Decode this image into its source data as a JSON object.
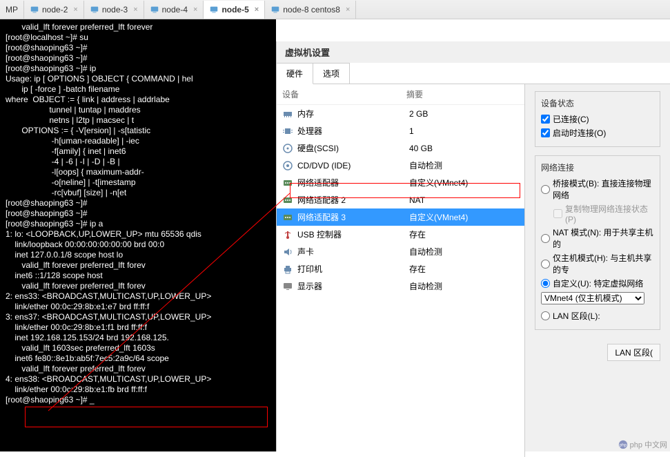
{
  "tabs": [
    {
      "label": "MP"
    },
    {
      "label": "node-2"
    },
    {
      "label": "node-3"
    },
    {
      "label": "node-4"
    },
    {
      "label": "node-5",
      "active": true
    },
    {
      "label": "node-8 centos8"
    }
  ],
  "terminal_lines": [
    "       valid_lft forever preferred_lft forever",
    "[root@localhost ~]# su",
    "[root@shaoping63 ~]#",
    "[root@shaoping63 ~]#",
    "[root@shaoping63 ~]# ip",
    "Usage: ip [ OPTIONS ] OBJECT { COMMAND | hel",
    "       ip [ -force ] -batch filename",
    "where  OBJECT := { link | address | addrlabe",
    "                   tunnel | tuntap | maddres",
    "                   netns | l2tp | macsec | t",
    "       OPTIONS := { -V[ersion] | -s[tatistic",
    "                    -h[uman-readable] | -iec",
    "                    -f[amily] { inet | inet6",
    "                    -4 | -6 | -I | -D | -B |",
    "                    -l[oops] { maximum-addr-",
    "                    -o[neline] | -t[imestamp",
    "                    -rc[vbuf] [size] | -n[et",
    "[root@shaoping63 ~]#",
    "[root@shaoping63 ~]#",
    "[root@shaoping63 ~]# ip a",
    "1: lo: <LOOPBACK,UP,LOWER_UP> mtu 65536 qdis",
    "    link/loopback 00:00:00:00:00:00 brd 00:0",
    "    inet 127.0.0.1/8 scope host lo",
    "       valid_lft forever preferred_lft forev",
    "    inet6 ::1/128 scope host",
    "       valid_lft forever preferred_lft forev",
    "2: ens33: <BROADCAST,MULTICAST,UP,LOWER_UP>",
    "    link/ether 00:0c:29:8b:e1:e7 brd ff:ff:f",
    "3: ens37: <BROADCAST,MULTICAST,UP,LOWER_UP>",
    "    link/ether 00:0c:29:8b:e1:f1 brd ff:ff:f",
    "    inet 192.168.125.153/24 brd 192.168.125.",
    "       valid_lft 1603sec preferred_lft 1603s",
    "    inet6 fe80::8e1b:ab5f:7ec5:2a9c/64 scope",
    "       valid_lft forever preferred_lft forev",
    "4: ens38: <BROADCAST,MULTICAST,UP,LOWER_UP>",
    "    link/ether 00:0c:29:8b:e1:fb brd ff:ff:f",
    "[root@shaoping63 ~]# _"
  ],
  "panel": {
    "title": "虚拟机设置",
    "tabs": [
      {
        "label": "硬件"
      },
      {
        "label": "选项"
      }
    ],
    "header": {
      "col1": "设备",
      "col2": "摘要"
    },
    "devices": [
      {
        "icon": "memory",
        "name": "内存",
        "summary": "2 GB"
      },
      {
        "icon": "cpu",
        "name": "处理器",
        "summary": "1"
      },
      {
        "icon": "disk",
        "name": "硬盘(SCSI)",
        "summary": "40 GB"
      },
      {
        "icon": "cd",
        "name": "CD/DVD (IDE)",
        "summary": "自动检测"
      },
      {
        "icon": "net",
        "name": "网络适配器",
        "summary": "自定义(VMnet4)"
      },
      {
        "icon": "net",
        "name": "网络适配器 2",
        "summary": "NAT"
      },
      {
        "icon": "net",
        "name": "网络适配器 3",
        "summary": "自定义(VMnet4)",
        "selected": true
      },
      {
        "icon": "usb",
        "name": "USB 控制器",
        "summary": "存在"
      },
      {
        "icon": "sound",
        "name": "声卡",
        "summary": "自动检测"
      },
      {
        "icon": "printer",
        "name": "打印机",
        "summary": "存在"
      },
      {
        "icon": "monitor",
        "name": "显示器",
        "summary": "自动检测"
      }
    ]
  },
  "details": {
    "status_title": "设备状态",
    "connected": "已连接(C)",
    "connect_on_power": "启动时连接(O)",
    "net_title": "网络连接",
    "bridged": "桥接模式(B): 直接连接物理网络",
    "replicate": "复制物理网络连接状态(P)",
    "nat": "NAT 模式(N): 用于共享主机的",
    "hostonly": "仅主机模式(H): 与主机共享的专",
    "custom": "自定义(U): 特定虚拟网络",
    "vmnet_select": "VMnet4 (仅主机模式)",
    "lan_segment": "LAN 区段(L):",
    "lan_btn": "LAN 区段("
  },
  "watermark": "php 中文网"
}
